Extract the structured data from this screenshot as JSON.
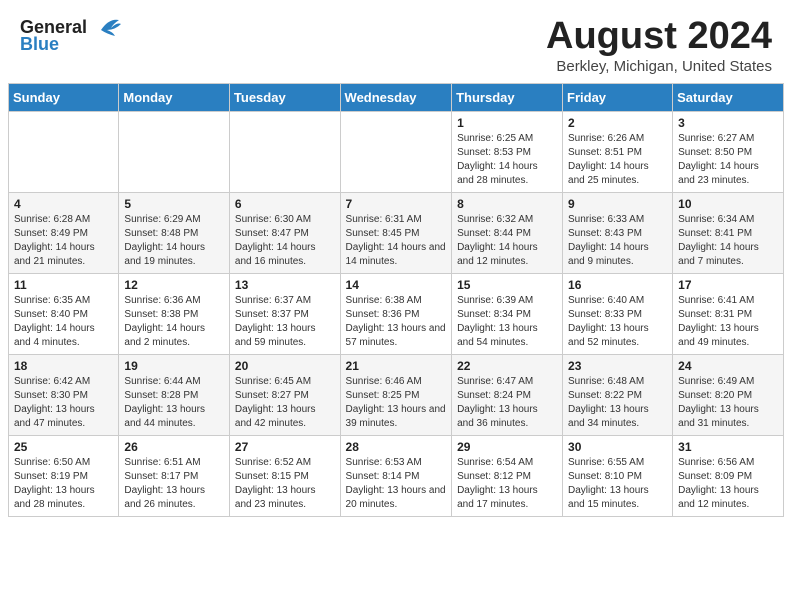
{
  "header": {
    "logo_general": "General",
    "logo_blue": "Blue",
    "title": "August 2024",
    "subtitle": "Berkley, Michigan, United States"
  },
  "weekdays": [
    "Sunday",
    "Monday",
    "Tuesday",
    "Wednesday",
    "Thursday",
    "Friday",
    "Saturday"
  ],
  "weeks": [
    [
      {
        "day": "",
        "info": ""
      },
      {
        "day": "",
        "info": ""
      },
      {
        "day": "",
        "info": ""
      },
      {
        "day": "",
        "info": ""
      },
      {
        "day": "1",
        "info": "Sunrise: 6:25 AM\nSunset: 8:53 PM\nDaylight: 14 hours and 28 minutes."
      },
      {
        "day": "2",
        "info": "Sunrise: 6:26 AM\nSunset: 8:51 PM\nDaylight: 14 hours and 25 minutes."
      },
      {
        "day": "3",
        "info": "Sunrise: 6:27 AM\nSunset: 8:50 PM\nDaylight: 14 hours and 23 minutes."
      }
    ],
    [
      {
        "day": "4",
        "info": "Sunrise: 6:28 AM\nSunset: 8:49 PM\nDaylight: 14 hours and 21 minutes."
      },
      {
        "day": "5",
        "info": "Sunrise: 6:29 AM\nSunset: 8:48 PM\nDaylight: 14 hours and 19 minutes."
      },
      {
        "day": "6",
        "info": "Sunrise: 6:30 AM\nSunset: 8:47 PM\nDaylight: 14 hours and 16 minutes."
      },
      {
        "day": "7",
        "info": "Sunrise: 6:31 AM\nSunset: 8:45 PM\nDaylight: 14 hours and 14 minutes."
      },
      {
        "day": "8",
        "info": "Sunrise: 6:32 AM\nSunset: 8:44 PM\nDaylight: 14 hours and 12 minutes."
      },
      {
        "day": "9",
        "info": "Sunrise: 6:33 AM\nSunset: 8:43 PM\nDaylight: 14 hours and 9 minutes."
      },
      {
        "day": "10",
        "info": "Sunrise: 6:34 AM\nSunset: 8:41 PM\nDaylight: 14 hours and 7 minutes."
      }
    ],
    [
      {
        "day": "11",
        "info": "Sunrise: 6:35 AM\nSunset: 8:40 PM\nDaylight: 14 hours and 4 minutes."
      },
      {
        "day": "12",
        "info": "Sunrise: 6:36 AM\nSunset: 8:38 PM\nDaylight: 14 hours and 2 minutes."
      },
      {
        "day": "13",
        "info": "Sunrise: 6:37 AM\nSunset: 8:37 PM\nDaylight: 13 hours and 59 minutes."
      },
      {
        "day": "14",
        "info": "Sunrise: 6:38 AM\nSunset: 8:36 PM\nDaylight: 13 hours and 57 minutes."
      },
      {
        "day": "15",
        "info": "Sunrise: 6:39 AM\nSunset: 8:34 PM\nDaylight: 13 hours and 54 minutes."
      },
      {
        "day": "16",
        "info": "Sunrise: 6:40 AM\nSunset: 8:33 PM\nDaylight: 13 hours and 52 minutes."
      },
      {
        "day": "17",
        "info": "Sunrise: 6:41 AM\nSunset: 8:31 PM\nDaylight: 13 hours and 49 minutes."
      }
    ],
    [
      {
        "day": "18",
        "info": "Sunrise: 6:42 AM\nSunset: 8:30 PM\nDaylight: 13 hours and 47 minutes."
      },
      {
        "day": "19",
        "info": "Sunrise: 6:44 AM\nSunset: 8:28 PM\nDaylight: 13 hours and 44 minutes."
      },
      {
        "day": "20",
        "info": "Sunrise: 6:45 AM\nSunset: 8:27 PM\nDaylight: 13 hours and 42 minutes."
      },
      {
        "day": "21",
        "info": "Sunrise: 6:46 AM\nSunset: 8:25 PM\nDaylight: 13 hours and 39 minutes."
      },
      {
        "day": "22",
        "info": "Sunrise: 6:47 AM\nSunset: 8:24 PM\nDaylight: 13 hours and 36 minutes."
      },
      {
        "day": "23",
        "info": "Sunrise: 6:48 AM\nSunset: 8:22 PM\nDaylight: 13 hours and 34 minutes."
      },
      {
        "day": "24",
        "info": "Sunrise: 6:49 AM\nSunset: 8:20 PM\nDaylight: 13 hours and 31 minutes."
      }
    ],
    [
      {
        "day": "25",
        "info": "Sunrise: 6:50 AM\nSunset: 8:19 PM\nDaylight: 13 hours and 28 minutes."
      },
      {
        "day": "26",
        "info": "Sunrise: 6:51 AM\nSunset: 8:17 PM\nDaylight: 13 hours and 26 minutes."
      },
      {
        "day": "27",
        "info": "Sunrise: 6:52 AM\nSunset: 8:15 PM\nDaylight: 13 hours and 23 minutes."
      },
      {
        "day": "28",
        "info": "Sunrise: 6:53 AM\nSunset: 8:14 PM\nDaylight: 13 hours and 20 minutes."
      },
      {
        "day": "29",
        "info": "Sunrise: 6:54 AM\nSunset: 8:12 PM\nDaylight: 13 hours and 17 minutes."
      },
      {
        "day": "30",
        "info": "Sunrise: 6:55 AM\nSunset: 8:10 PM\nDaylight: 13 hours and 15 minutes."
      },
      {
        "day": "31",
        "info": "Sunrise: 6:56 AM\nSunset: 8:09 PM\nDaylight: 13 hours and 12 minutes."
      }
    ]
  ]
}
